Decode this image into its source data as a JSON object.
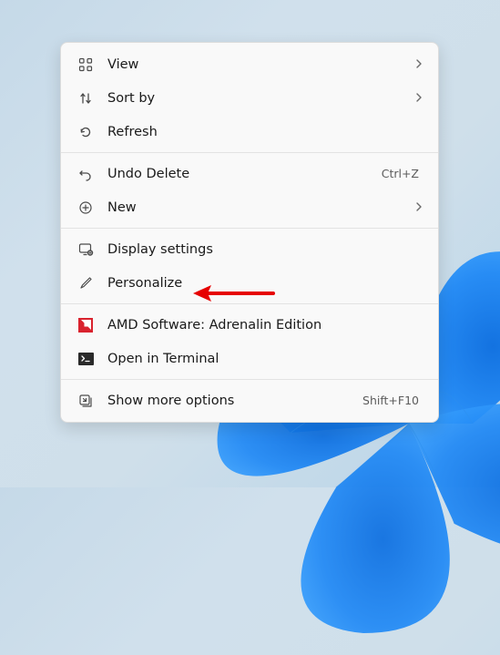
{
  "menu": {
    "view": "View",
    "sortby": "Sort by",
    "refresh": "Refresh",
    "undoDelete": "Undo Delete",
    "undoDeleteKey": "Ctrl+Z",
    "new": "New",
    "displaySettings": "Display settings",
    "personalize": "Personalize",
    "amd": "AMD Software: Adrenalin Edition",
    "openTerminal": "Open in Terminal",
    "showMore": "Show more options",
    "showMoreKey": "Shift+F10"
  },
  "annotation": {
    "target": "personalize"
  }
}
